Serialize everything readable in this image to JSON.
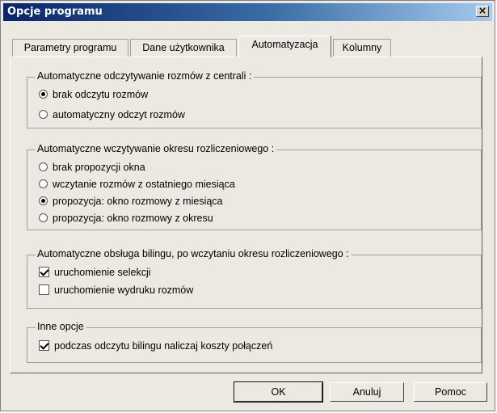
{
  "window": {
    "title": "Opcje programu",
    "close": "×"
  },
  "tabs": [
    {
      "label": "Parametry programu"
    },
    {
      "label": "Dane użytkownika"
    },
    {
      "label": "Automatyzacja"
    },
    {
      "label": "Kolumny"
    }
  ],
  "groups": {
    "odczyt": {
      "title": "Automatyczne odczytywanie rozmów z centrali :",
      "options": [
        {
          "label": "brak odczytu rozmów",
          "selected": true
        },
        {
          "label": "automatyczny odczyt rozmów",
          "selected": false
        }
      ]
    },
    "okres": {
      "title": "Automatyczne wczytywanie okresu rozliczeniowego :",
      "options": [
        {
          "label": "brak propozycji okna",
          "selected": false
        },
        {
          "label": "wczytanie rozmów z ostatniego miesiąca",
          "selected": false
        },
        {
          "label": "propozycja: okno rozmowy z miesiąca",
          "selected": true
        },
        {
          "label": "propozycja: okno rozmowy z okresu",
          "selected": false
        }
      ]
    },
    "bilingi": {
      "title": "Automatyczne obsługa bilingu, po wczytaniu okresu rozliczeniowego :",
      "options": [
        {
          "label": "uruchomienie selekcji",
          "checked": true
        },
        {
          "label": "uruchomienie wydruku rozmów",
          "checked": false
        }
      ]
    },
    "inne": {
      "title": "Inne opcje",
      "options": [
        {
          "label": "podczas odczytu bilingu naliczaj koszty połączeń",
          "checked": true
        }
      ]
    }
  },
  "buttons": {
    "ok": "OK",
    "cancel": "Anuluj",
    "help": "Pomoc"
  }
}
